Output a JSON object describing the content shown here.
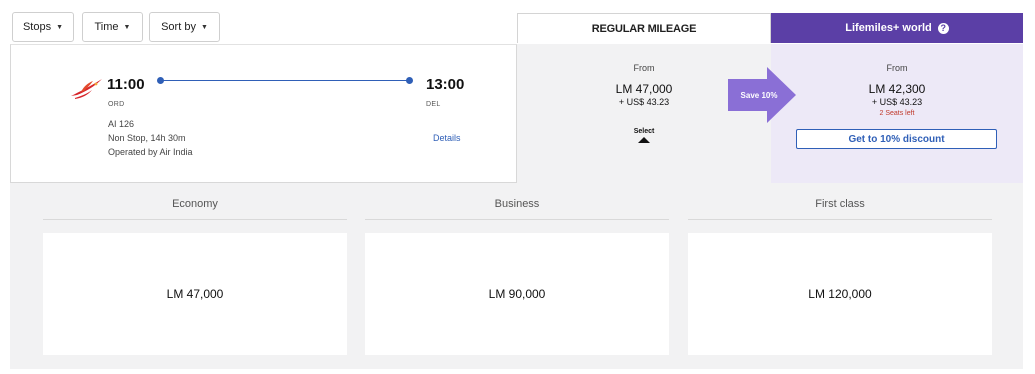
{
  "filters": [
    {
      "label": "Stops"
    },
    {
      "label": "Time"
    },
    {
      "label": "Sort by"
    }
  ],
  "tabs": {
    "regular": "REGULAR MILEAGE",
    "lifemiles": "Lifemiles+ world",
    "lifemiles_icon": "help-icon"
  },
  "flight": {
    "depart_time": "11:00",
    "depart_airport": "ORD",
    "arrive_time": "13:00",
    "arrive_airport": "DEL",
    "flight_number": "AI 126",
    "duration": "Non Stop, 14h 30m",
    "operator": "Operated by Air India",
    "details_label": "Details",
    "logo_icon": "air-india-logo-icon"
  },
  "regular_price": {
    "from": "From",
    "miles": "LM 47,000",
    "usd": "+ US$ 43.23",
    "select_label": "Select"
  },
  "save_badge": "Save 10%",
  "lifemiles_price": {
    "from": "From",
    "miles": "LM 42,300",
    "usd": "+ US$ 43.23",
    "seats": "2 Seats left",
    "discount_label": "Get to 10% discount"
  },
  "cabins": [
    {
      "label": "Economy",
      "price": "LM 47,000"
    },
    {
      "label": "Business",
      "price": "LM 90,000"
    },
    {
      "label": "First class",
      "price": "LM 120,000"
    }
  ],
  "colors": {
    "accent_purple": "#5b3fa6",
    "save_arrow": "#8a6fd6",
    "link_blue": "#2f5fb7",
    "seats_red": "#c0392b",
    "air_india_red": "#d7262b"
  }
}
